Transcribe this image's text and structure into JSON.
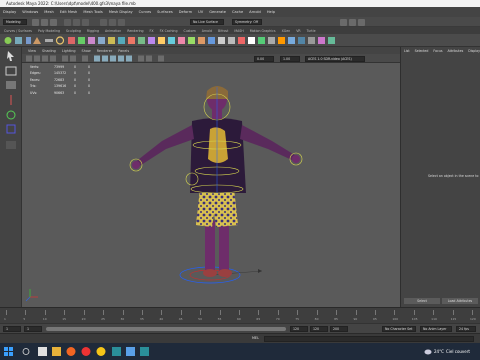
{
  "window": {
    "title": "Autodesk Maya 2022: C:\\Users\\dpt\\model\\400.gfs3\\maya file.mb"
  },
  "menubar": {
    "items": [
      "Display",
      "Windows",
      "Mesh",
      "Edit Mesh",
      "Mesh Tools",
      "Mesh Display",
      "Curves",
      "Surfaces",
      "Deform",
      "UV",
      "Generate",
      "Cache",
      "Arnold",
      "Help"
    ],
    "mode_dropdown": "Modeling",
    "no_live_surface": "No Live Surface",
    "symmetry": "Symmetry: Off"
  },
  "shelf_tabs": [
    "Curves / Surfaces",
    "Poly Modeling",
    "Sculpting",
    "Rigging",
    "Animation",
    "Rendering",
    "FX",
    "FX Caching",
    "Custom",
    "Arnold",
    "Bifrost",
    "MASH",
    "Motion Graphics",
    "XGen",
    "VR",
    "Turtle"
  ],
  "panel_menu": [
    "View",
    "Shading",
    "Lighting",
    "Show",
    "Renderer",
    "Panels"
  ],
  "panel_toolbar": {
    "exposure": "0.00",
    "gamma": "1.00",
    "colorspace": "ACES 1.0 SDR-video (ACES)"
  },
  "hud": {
    "rows": [
      {
        "label": "Verts:",
        "total": "73999",
        "sel1": "0",
        "sel2": "0"
      },
      {
        "label": "Edges:",
        "total": "145372",
        "sel1": "0",
        "sel2": "0"
      },
      {
        "label": "Faces:",
        "total": "72683",
        "sel1": "0",
        "sel2": "0"
      },
      {
        "label": "Tris:",
        "total": "139616",
        "sel1": "0",
        "sel2": "0"
      },
      {
        "label": "UVs:",
        "total": "90663",
        "sel1": "0",
        "sel2": "0"
      }
    ]
  },
  "right_panel": {
    "tabs": [
      "List",
      "Selected",
      "Focus",
      "Attributes",
      "Display"
    ],
    "message": "Select an object in the scene to",
    "select_button": "Select",
    "load_button": "Load Attributes"
  },
  "timeline": {
    "tick_labels": [
      "1",
      "5",
      "10",
      "15",
      "20",
      "25",
      "30",
      "35",
      "40",
      "45",
      "50",
      "55",
      "60",
      "65",
      "70",
      "75",
      "80",
      "85",
      "90",
      "95",
      "100",
      "105",
      "110",
      "115",
      "120"
    ]
  },
  "range": {
    "start": "1",
    "inner_start": "1",
    "inner_end": "120",
    "end": "120",
    "end2": "200",
    "character_set": "No Character Set",
    "anim_layer": "No Anim Layer",
    "fps": "24 fps"
  },
  "cmdline": {
    "label": "MEL"
  },
  "taskbar": {
    "weather_temp": "24°C",
    "weather_desc": "Ciel couvert"
  },
  "colors": {
    "viewport_bg": "#5a5a5a",
    "ui_bg": "#444444",
    "accent": "#5285a6"
  }
}
